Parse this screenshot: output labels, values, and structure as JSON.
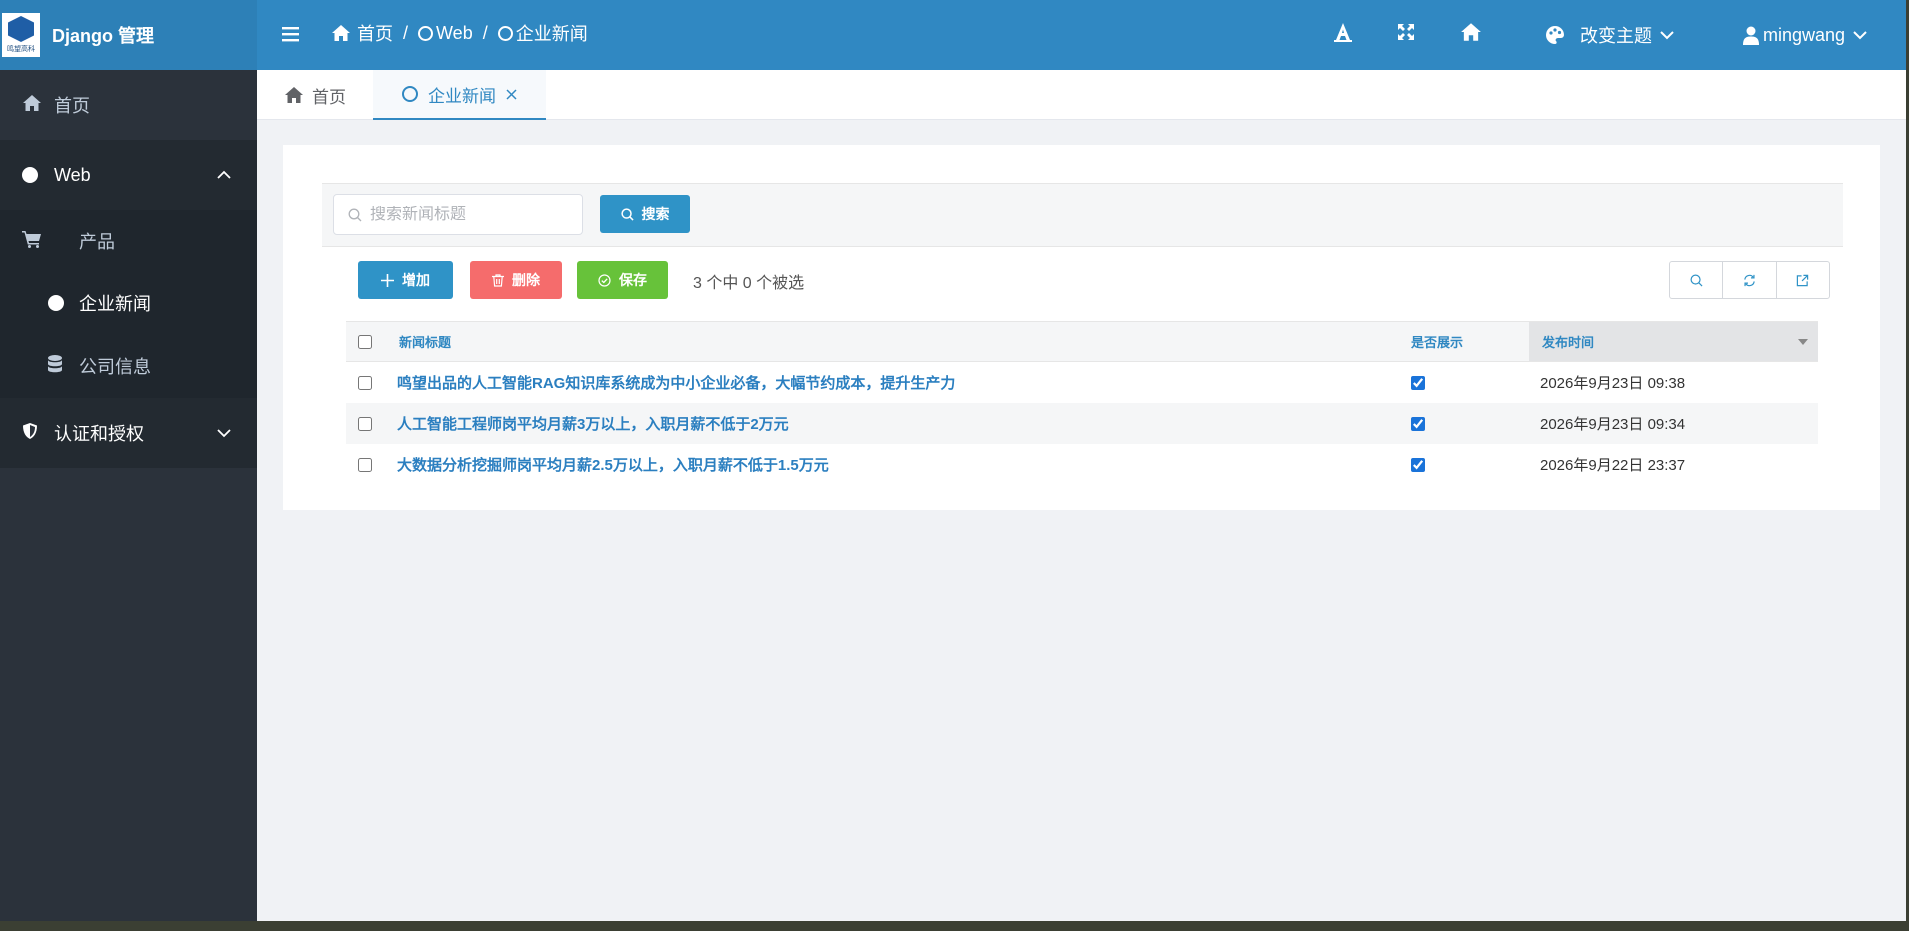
{
  "header": {
    "app_title": "Django 管理",
    "logo_sub": "鸣望高科",
    "breadcrumb": [
      "首页",
      "Web",
      "企业新闻"
    ],
    "theme_label": "改变主题",
    "user_label": "mingwang"
  },
  "sidebar": {
    "home": "首页",
    "web_group": "Web",
    "web_items": [
      "产品",
      "企业新闻",
      "公司信息"
    ],
    "auth_group": "认证和授权"
  },
  "tabs": [
    {
      "label": "首页"
    },
    {
      "label": "企业新闻"
    }
  ],
  "search": {
    "placeholder": "搜索新闻标题",
    "button": "搜索"
  },
  "actions": {
    "add": "增加",
    "delete": "删除",
    "save": "保存",
    "selection_count": "3 个中 0 个被选"
  },
  "table": {
    "columns": [
      "新闻标题",
      "是否展示",
      "发布时间"
    ],
    "rows": [
      {
        "title": "鸣望出品的人工智能RAG知识库系统成为中小企业必备，大幅节约成本，提升生产力",
        "shown": true,
        "date": "2026年9月23日 09:38"
      },
      {
        "title": "人工智能工程师岗平均月薪3万以上，入职月薪不低于2万元",
        "shown": true,
        "date": "2026年9月23日 09:34"
      },
      {
        "title": "大数据分析挖掘师岗平均月薪2.5万以上，入职月薪不低于1.5万元",
        "shown": true,
        "date": "2026年9月22日 23:37"
      }
    ]
  },
  "colors": {
    "header_bg": "#3088c2",
    "sidebar_bg": "#2b323b",
    "primary": "#2f93c7",
    "danger": "#f56c6c",
    "success": "#67c23a"
  },
  "icons": [
    "menu-icon",
    "home-icon",
    "circle-icon",
    "font-icon",
    "fullscreen-icon",
    "palette-icon",
    "user-icon",
    "chevron-down-icon",
    "cart-icon",
    "database-icon",
    "shield-icon",
    "search-icon",
    "plus-icon",
    "trash-icon",
    "check-circle-icon",
    "refresh-icon",
    "export-icon",
    "close-icon",
    "sort-icon"
  ]
}
